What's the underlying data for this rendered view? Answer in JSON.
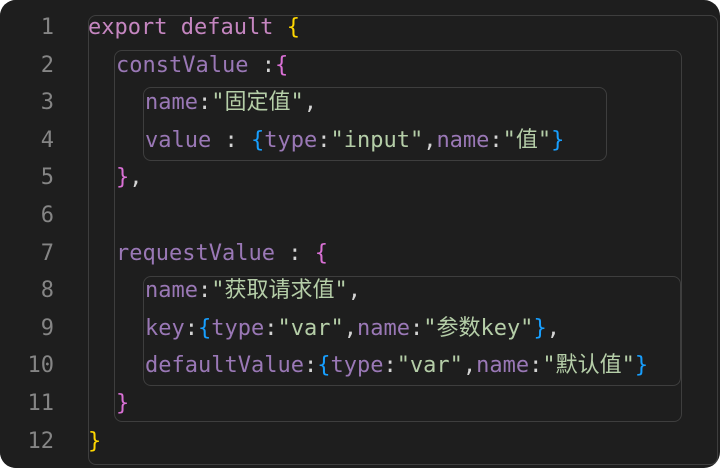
{
  "line_numbers": [
    "1",
    "2",
    "3",
    "4",
    "5",
    "6",
    "7",
    "8",
    "9",
    "10",
    "11",
    "12"
  ],
  "code": {
    "l1": {
      "kw": "export default",
      "brace": "{"
    },
    "l2": {
      "prop": "constValue",
      "sep": " :",
      "brace": "{"
    },
    "l3": {
      "prop": "name",
      "colon": ":",
      "str": "\"固定值\"",
      "comma": ","
    },
    "l4": {
      "prop": "value",
      "colon": " : ",
      "brace_open": "{",
      "k1": "type",
      "c1": ":",
      "v1": "\"input\"",
      "cm": ",",
      "k2": "name",
      "c2": ":",
      "v2": "\"值\"",
      "brace_close": "}"
    },
    "l5": {
      "brace": "}",
      "comma": ","
    },
    "l7": {
      "prop": "requestValue",
      "colon": " : ",
      "brace": "{"
    },
    "l8": {
      "prop": "name",
      "colon": ":",
      "str": "\"获取请求值\"",
      "comma": ","
    },
    "l9": {
      "prop": "key",
      "colon": ":",
      "brace_open": "{",
      "k1": "type",
      "c1": ":",
      "v1": "\"var\"",
      "cm": ",",
      "k2": "name",
      "c2": ":",
      "v2": "\"参数key\"",
      "brace_close": "}",
      "comma": ","
    },
    "l10": {
      "prop": "defaultValue",
      "colon": ":",
      "brace_open": "{",
      "k1": "type",
      "c1": ":",
      "v1": "\"var\"",
      "cm": ",",
      "k2": "name",
      "c2": ":",
      "v2": "\"默认值\"",
      "brace_close": "}"
    },
    "l11": {
      "brace": "}"
    },
    "l12": {
      "brace": "}"
    }
  },
  "colors": {
    "background": "#1e1e1e",
    "keyword": "#c586c0",
    "property": "#9a78b6",
    "string": "#b5cea8",
    "bracket_level1": "#ffd700",
    "bracket_level2": "#da70d6",
    "bracket_level3": "#179fff"
  }
}
